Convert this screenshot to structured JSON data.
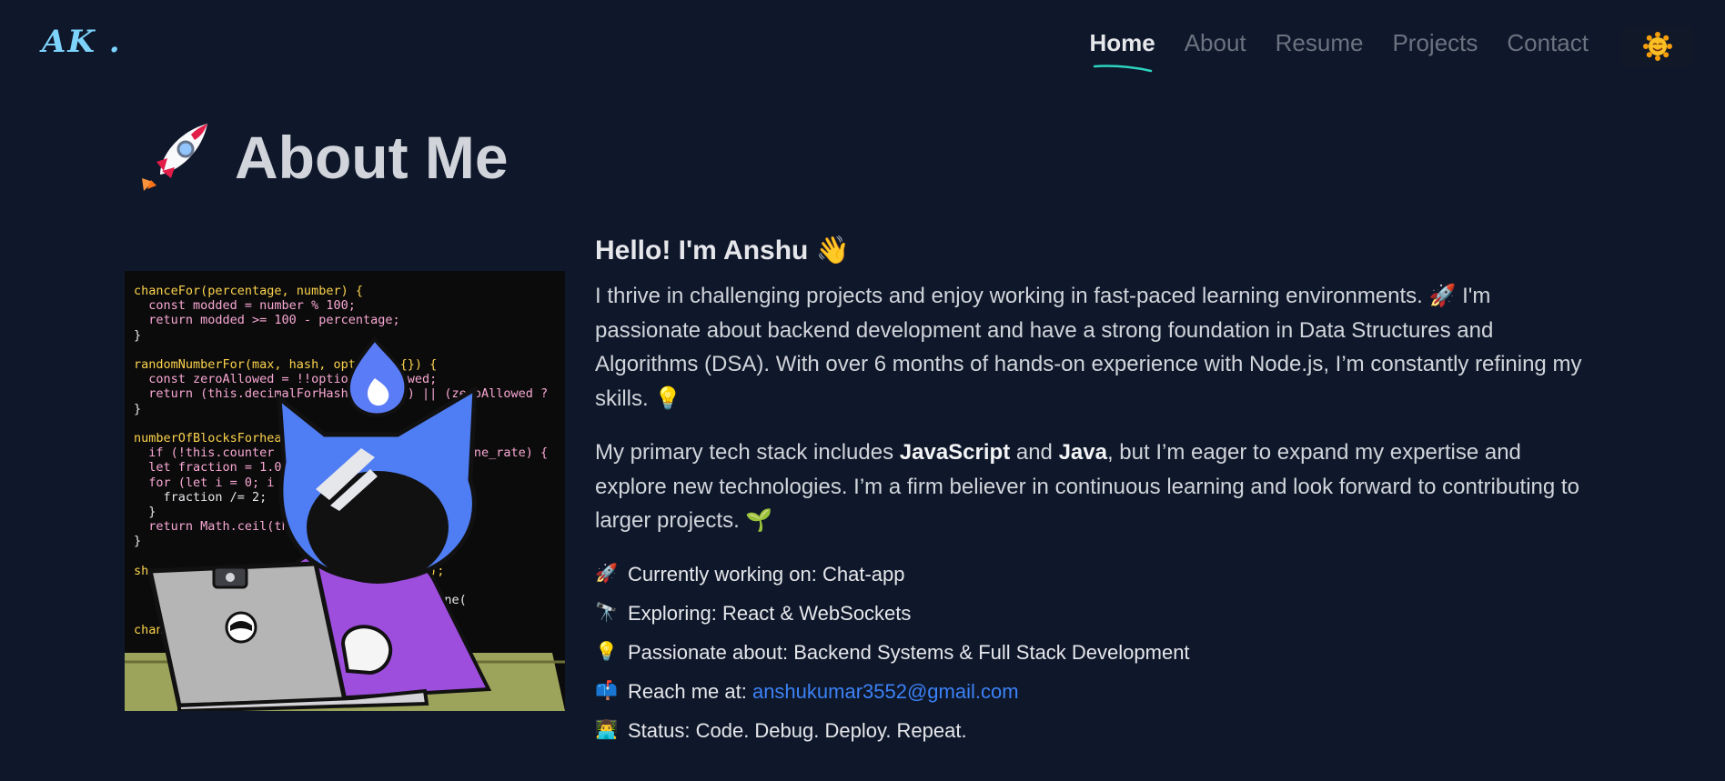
{
  "nav": {
    "logo": "AK .",
    "links": [
      {
        "label": "Home",
        "active": true
      },
      {
        "label": "About"
      },
      {
        "label": "Resume"
      },
      {
        "label": "Projects"
      },
      {
        "label": "Contact"
      }
    ],
    "theme_toggle_icon": "sun-icon"
  },
  "colors": {
    "background": "#0f172a",
    "accent": "#2dd4bf",
    "link": "#3b82f6"
  },
  "about": {
    "title": "About Me",
    "greeting": "Hello! I'm Anshu",
    "greeting_emoji": "👋",
    "p1": "I thrive in challenging projects and enjoy working in fast-paced learning environments. 🚀 I'm passionate about backend development and have a strong foundation in Data Structures and Algorithms (DSA). With over 6 months of hands-on experience with Node.js, I’m constantly refining my skills. 💡",
    "p2_a": "My primary tech stack includes ",
    "p2_b1": "JavaScript",
    "p2_c": " and ",
    "p2_b2": "Java",
    "p2_d": ", but I’m eager to expand my expertise and explore new technologies. I’m a firm believer in continuous learning and look forward to contributing to larger projects. 🌱",
    "facts": [
      {
        "emoji": "🚀",
        "text": "Currently working on: Chat-app"
      },
      {
        "emoji": "🔭",
        "text": "Exploring: React & WebSockets"
      },
      {
        "emoji": "💡",
        "text": "Passionate about: Backend Systems & Full Stack Development"
      },
      {
        "emoji": "📫",
        "text": "Reach me at: ",
        "link": "anshukumar3552@gmail.com"
      },
      {
        "emoji": "👨‍💻",
        "text": "Status: Code. Debug. Deploy. Repeat."
      }
    ]
  },
  "illustration": {
    "code": [
      "chanceFor(percentage, number) {",
      "  const modded = number % 100;",
      "  return modded >= 100 - percentage;",
      "}",
      "",
      "randomNumberFor(max, hash, opti     {}) {",
      "  const zeroAllowed = !!optio     llowed;",
      "  return (this.decimalForHash     max) || (zeroAllowed ?",
      "}",
      "",
      "numberOfBlocksForhealthDecline() {",
      "  if (!this.counter || this.behavior.he     line_rate) {",
      "  let fraction = 1.0            ne_rate;",
      "  for (let i = 0; i ",
      "    fraction /= 2;",
      "  }",
      "  return Math.ceil(th              _interval *",
      "}",
      "",
      "sh                                cline();",
      "",
      "                                  lthDecline(",
      "",
      "chanc"
    ]
  }
}
